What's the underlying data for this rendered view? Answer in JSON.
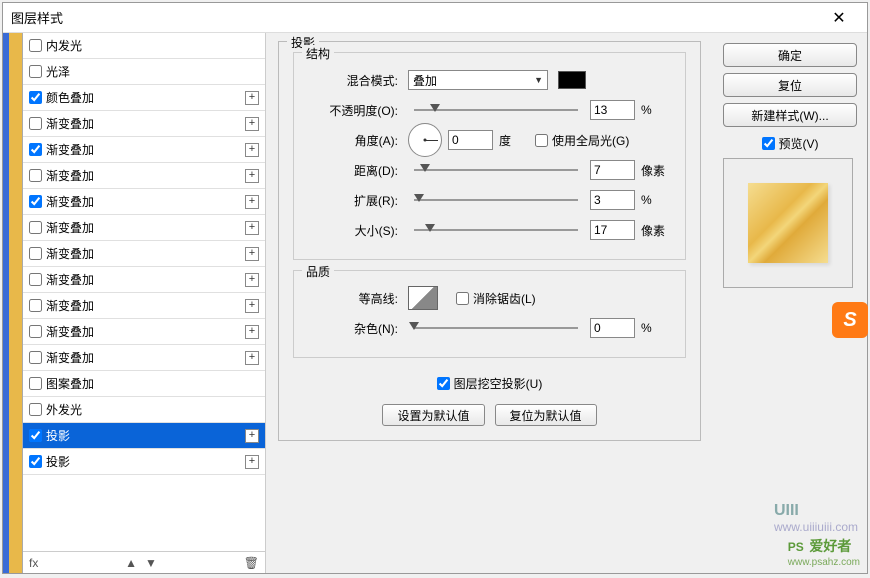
{
  "window": {
    "title": "图层样式"
  },
  "styles": [
    {
      "checked": false,
      "label": "内发光",
      "add": false
    },
    {
      "checked": false,
      "label": "光泽",
      "add": false
    },
    {
      "checked": true,
      "label": "颜色叠加",
      "add": true
    },
    {
      "checked": false,
      "label": "渐变叠加",
      "add": true
    },
    {
      "checked": true,
      "label": "渐变叠加",
      "add": true
    },
    {
      "checked": false,
      "label": "渐变叠加",
      "add": true
    },
    {
      "checked": true,
      "label": "渐变叠加",
      "add": true
    },
    {
      "checked": false,
      "label": "渐变叠加",
      "add": true
    },
    {
      "checked": false,
      "label": "渐变叠加",
      "add": true
    },
    {
      "checked": false,
      "label": "渐变叠加",
      "add": true
    },
    {
      "checked": false,
      "label": "渐变叠加",
      "add": true
    },
    {
      "checked": false,
      "label": "渐变叠加",
      "add": true
    },
    {
      "checked": false,
      "label": "渐变叠加",
      "add": true
    },
    {
      "checked": false,
      "label": "图案叠加",
      "add": false
    },
    {
      "checked": false,
      "label": "外发光",
      "add": false
    },
    {
      "checked": true,
      "label": "投影",
      "add": true,
      "selected": true
    },
    {
      "checked": true,
      "label": "投影",
      "add": true
    }
  ],
  "footer_fx": "fx",
  "panel": {
    "title": "投影",
    "structure": {
      "title": "结构",
      "blend_label": "混合模式:",
      "blend_value": "叠加",
      "opacity_label": "不透明度(O):",
      "opacity_value": "13",
      "opacity_unit": "%",
      "angle_label": "角度(A):",
      "angle_value": "0",
      "angle_unit": "度",
      "global_light": "使用全局光(G)",
      "distance_label": "距离(D):",
      "distance_value": "7",
      "distance_unit": "像素",
      "spread_label": "扩展(R):",
      "spread_value": "3",
      "spread_unit": "%",
      "size_label": "大小(S):",
      "size_value": "17",
      "size_unit": "像素"
    },
    "quality": {
      "title": "品质",
      "contour_label": "等高线:",
      "antialias": "消除锯齿(L)",
      "noise_label": "杂色(N):",
      "noise_value": "0",
      "noise_unit": "%"
    },
    "knockout": "图层挖空投影(U)",
    "defaults_set": "设置为默认值",
    "defaults_reset": "复位为默认值"
  },
  "right": {
    "ok": "确定",
    "reset": "复位",
    "new_style": "新建样式(W)...",
    "preview": "预览(V)"
  },
  "watermark1a": "UIII",
  "watermark1b": "www.uiiiuiii.com",
  "watermark2a": "PS",
  "watermark2b": "爱好者",
  "watermark2c": "www.psahz.com"
}
